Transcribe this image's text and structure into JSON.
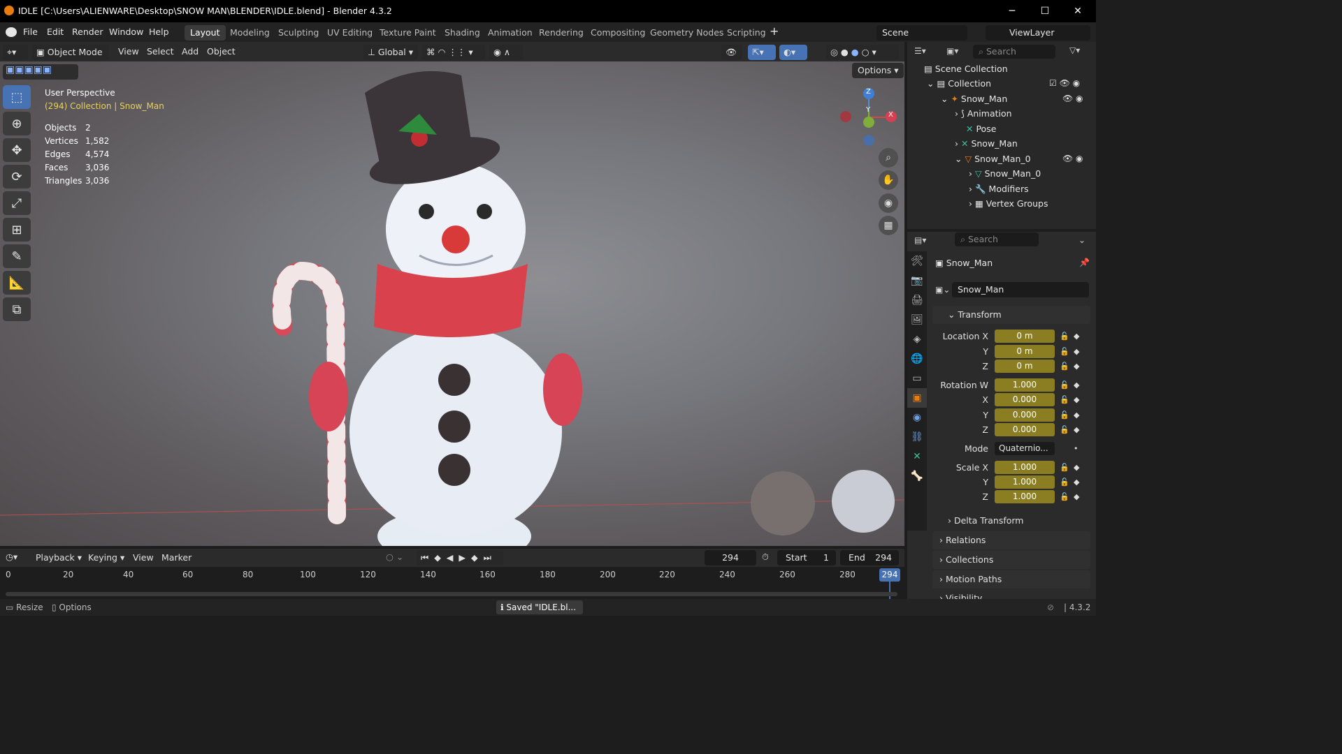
{
  "titlebar": {
    "title": "IDLE [C:\\Users\\ALIENWARE\\Desktop\\SNOW MAN\\BLENDER\\IDLE.blend] - Blender 4.3.2",
    "minimize": "─",
    "maximize": "☐",
    "close": "✕"
  },
  "menus": [
    "File",
    "Edit",
    "Render",
    "Window",
    "Help"
  ],
  "workspaces": [
    "Layout",
    "Modeling",
    "Sculpting",
    "UV Editing",
    "Texture Paint",
    "Shading",
    "Animation",
    "Rendering",
    "Compositing",
    "Geometry Nodes",
    "Scripting"
  ],
  "scene_name": "Scene",
  "viewlayer_name": "ViewLayer",
  "header3d": {
    "mode": "Object Mode",
    "menus": [
      "View",
      "Select",
      "Add",
      "Object"
    ],
    "orientation": "Global",
    "options": "Options"
  },
  "viewport": {
    "perspective": "User Perspective",
    "context": "(294) Collection | Snow_Man",
    "stats": [
      {
        "k": "Objects",
        "v": "2"
      },
      {
        "k": "Vertices",
        "v": "1,582"
      },
      {
        "k": "Edges",
        "v": "4,574"
      },
      {
        "k": "Faces",
        "v": "3,036"
      },
      {
        "k": "Triangles",
        "v": "3,036"
      }
    ],
    "gizmo": {
      "z": "Z",
      "y": "Y",
      "x": "X"
    }
  },
  "timeline": {
    "menus": [
      "Playback",
      "Keying",
      "View",
      "Marker"
    ],
    "current": "294",
    "start_label": "Start",
    "start": "1",
    "end_label": "End",
    "end": "294",
    "ticks": [
      "0",
      "20",
      "40",
      "60",
      "80",
      "100",
      "120",
      "140",
      "160",
      "180",
      "200",
      "220",
      "240",
      "260",
      "280"
    ],
    "playhead": "294"
  },
  "outliner": {
    "search": "Search",
    "items": [
      "Scene Collection",
      "Collection",
      "Snow_Man",
      "Animation",
      "Pose",
      "Snow_Man",
      "Snow_Man_0",
      "Snow_Man_0",
      "Modifiers",
      "Vertex Groups"
    ]
  },
  "properties": {
    "search": "Search",
    "object_name": "Snow_Man",
    "data_name": "Snow_Man",
    "transform": "Transform",
    "location": [
      {
        "label": "Location X",
        "v": "0 m"
      },
      {
        "label": "Y",
        "v": "0 m"
      },
      {
        "label": "Z",
        "v": "0 m"
      }
    ],
    "rotation": [
      {
        "label": "Rotation W",
        "v": "1.000"
      },
      {
        "label": "X",
        "v": "0.000"
      },
      {
        "label": "Y",
        "v": "0.000"
      },
      {
        "label": "Z",
        "v": "0.000"
      }
    ],
    "mode_label": "Mode",
    "mode": "Quaternio...",
    "scale": [
      {
        "label": "Scale X",
        "v": "1.000"
      },
      {
        "label": "Y",
        "v": "1.000"
      },
      {
        "label": "Z",
        "v": "1.000"
      }
    ],
    "sections": [
      "Delta Transform",
      "Relations",
      "Collections",
      "Motion Paths",
      "Visibility"
    ]
  },
  "status": {
    "resize": "Resize",
    "options": "Options",
    "message": "Saved \"IDLE.bl...",
    "version": "4.3.2"
  }
}
